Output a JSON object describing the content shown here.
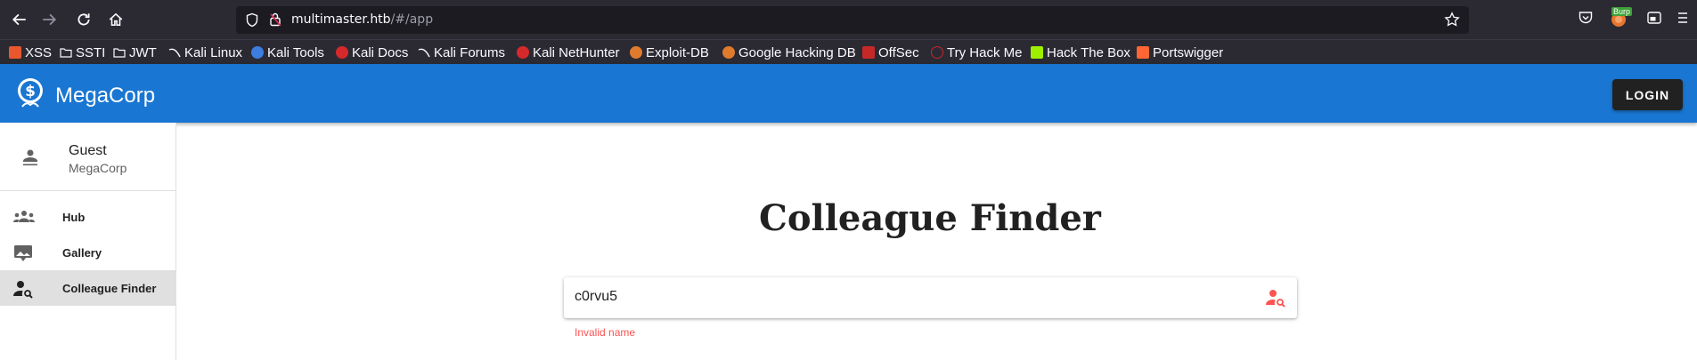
{
  "browser": {
    "url_host": "multimaster.htb",
    "url_path": "/#/app",
    "burp_badge": "Burp"
  },
  "bookmarks": [
    {
      "label": "XSS",
      "color": "#e8572d"
    },
    {
      "label": "SSTI",
      "color": "folder"
    },
    {
      "label": "JWT",
      "color": "folder"
    },
    {
      "label": "Kali Linux",
      "color": "#2a2a2a"
    },
    {
      "label": "Kali Tools",
      "color": "#3c7de0"
    },
    {
      "label": "Kali Docs",
      "color": "#d6292b"
    },
    {
      "label": "Kali Forums",
      "color": "#2a2a2a"
    },
    {
      "label": "Kali NetHunter",
      "color": "#d6292b"
    },
    {
      "label": "Exploit-DB",
      "color": "#e07a2d"
    },
    {
      "label": "Google Hacking DB",
      "color": "#e07a2d"
    },
    {
      "label": "OffSec",
      "color": "#c62828"
    },
    {
      "label": "Try Hack Me",
      "color": "#c62828"
    },
    {
      "label": "Hack The Box",
      "color": "#9fef00"
    },
    {
      "label": "Portswigger",
      "color": "#ff6633"
    }
  ],
  "appbar": {
    "brand": "MegaCorp",
    "login_label": "LOGIN",
    "color": "#1976d2"
  },
  "sidebar": {
    "user_name": "Guest",
    "user_org": "MegaCorp",
    "items": [
      {
        "label": "Hub",
        "icon": "group-icon",
        "active": false
      },
      {
        "label": "Gallery",
        "icon": "gallery-icon",
        "active": false
      },
      {
        "label": "Colleague Finder",
        "icon": "person-search-icon",
        "active": true
      }
    ]
  },
  "main": {
    "title": "Colleague Finder",
    "search_value": "c0rvu5",
    "error": "Invalid name",
    "error_color": "#ff5252"
  }
}
